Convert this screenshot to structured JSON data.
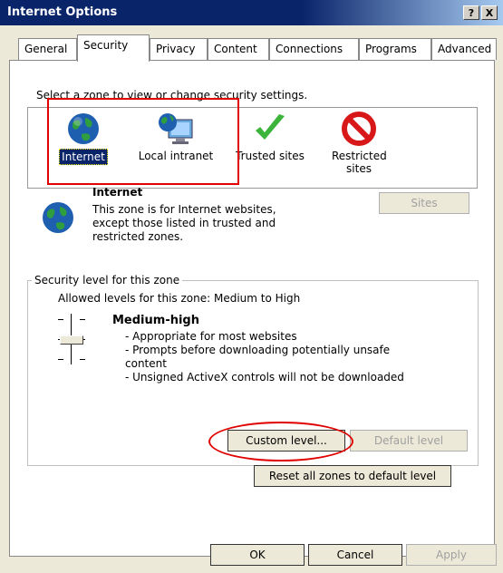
{
  "window": {
    "title": "Internet Options",
    "help_btn": "?",
    "close_btn": "X"
  },
  "tabs": [
    {
      "label": "General"
    },
    {
      "label": "Security"
    },
    {
      "label": "Privacy"
    },
    {
      "label": "Content"
    },
    {
      "label": "Connections"
    },
    {
      "label": "Programs"
    },
    {
      "label": "Advanced"
    }
  ],
  "zones": {
    "instruction": "Select a zone to view or change security settings.",
    "items": [
      {
        "label": "Internet",
        "icon": "globe-icon"
      },
      {
        "label": "Local intranet",
        "icon": "computer-globe-icon"
      },
      {
        "label": "Trusted sites",
        "icon": "checkmark-icon"
      },
      {
        "label": "Restricted sites",
        "icon": "no-entry-icon"
      }
    ],
    "selected": "Internet"
  },
  "zone_info": {
    "title": "Internet",
    "description": "This zone is for Internet websites, except those listed in trusted and restricted zones.",
    "sites_button": "Sites"
  },
  "security_level": {
    "group_label": "Security level for this zone",
    "allowed": "Allowed levels for this zone: Medium to High",
    "level_name": "Medium-high",
    "bullets": [
      "- Appropriate for most websites",
      "- Prompts before downloading potentially unsafe content",
      "- Unsigned ActiveX controls will not be downloaded"
    ],
    "custom_button": "Custom level...",
    "default_button": "Default level",
    "reset_button": "Reset all zones to default level"
  },
  "footer": {
    "ok": "OK",
    "cancel": "Cancel",
    "apply": "Apply"
  },
  "colors": {
    "titlebar": "#0a246a",
    "annotation_red": "#e00000",
    "dialog_bg": "#ece9d8"
  }
}
